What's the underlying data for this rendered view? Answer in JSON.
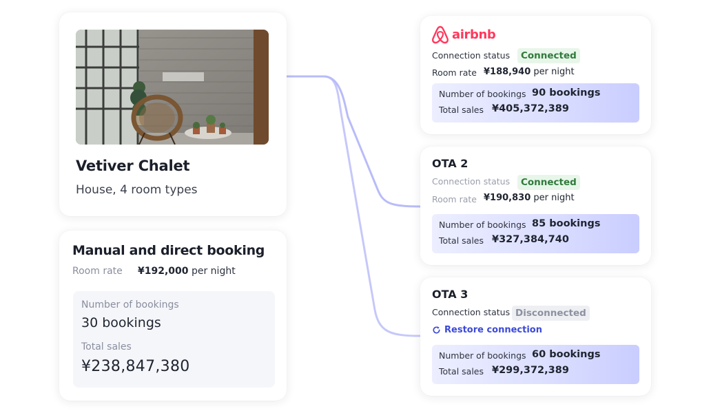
{
  "property": {
    "name": "Vetiver Chalet",
    "subtitle": "House, 4 room types",
    "photo": "property-photo"
  },
  "manual": {
    "title": "Manual and direct booking",
    "room_rate_label": "Room rate",
    "room_rate_value": "¥192,000",
    "room_rate_unit": "per night",
    "bookings_label": "Number of bookings",
    "bookings_value": "30 bookings",
    "sales_label": "Total sales",
    "sales_value": "¥238,847,380"
  },
  "otas": [
    {
      "brand": "airbnb",
      "status_label": "Connection status",
      "status": "Connected",
      "rate_label": "Room rate",
      "rate_value": "¥188,940",
      "rate_unit": "per night",
      "bookings_label": "Number of bookings",
      "bookings_value": "90 bookings",
      "sales_label": "Total sales",
      "sales_value": "¥405,372,389"
    },
    {
      "name": "OTA 2",
      "status_label": "Connection status",
      "status": "Connected",
      "rate_label": "Room rate",
      "rate_value": "¥190,830",
      "rate_unit": "per night",
      "bookings_label": "Number of bookings",
      "bookings_value": "85 bookings",
      "sales_label": "Total sales",
      "sales_value": "¥327,384,740"
    },
    {
      "name": "OTA 3",
      "status_label": "Connection status",
      "status": "Disconnected",
      "restore_label": "Restore connection",
      "bookings_label": "Number of bookings",
      "bookings_value": "60 bookings",
      "sales_label": "Total sales",
      "sales_value": "¥299,372,389"
    }
  ],
  "colors": {
    "airbnb_brand": "#ff385c",
    "connected_bg": "#e8f6ea",
    "connected_text": "#2f7a3b",
    "disconnected_bg": "#eeeff3",
    "disconnected_text": "#8d91a0",
    "link": "#3b49d8",
    "connector": "#5b5ff0"
  },
  "icons": {
    "airbnb": "airbnb-logo-icon",
    "restore": "refresh-icon"
  }
}
